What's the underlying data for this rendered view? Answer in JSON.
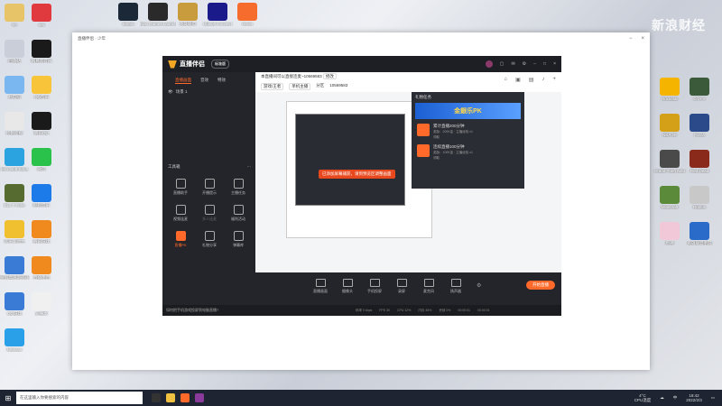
{
  "desktop": {
    "watermark": "新浪财经",
    "left_icons": [
      {
        "label": "hy",
        "color": "#e8c468"
      },
      {
        "label": "回收站",
        "color": "#c9ced8"
      },
      {
        "label": "此电脑",
        "color": "#7ab7f0"
      },
      {
        "label": "控制面板",
        "color": "#e8e8e8"
      },
      {
        "label": "Microsoft Edge",
        "color": "#2aa3e0"
      },
      {
        "label": "Eco 7 Fobs",
        "color": "#556b2f"
      },
      {
        "label": "欢乐斗地主",
        "color": "#f0c030"
      },
      {
        "label": "搜狗高速浏览器",
        "color": "#3a7bd5"
      },
      {
        "label": "QQ游戏",
        "color": "#3a7bd5"
      },
      {
        "label": "Netease",
        "color": "#29a0e8"
      }
    ],
    "left_icons2": [
      {
        "label": "ww",
        "color": "#e0393e"
      },
      {
        "label": "网易云音乐",
        "color": "#1a1a1a"
      },
      {
        "label": "QQ音乐",
        "color": "#f7c43a"
      },
      {
        "label": "腾讯QQ",
        "color": "#1a1a1a"
      },
      {
        "label": "微信",
        "color": "#2bc24b"
      },
      {
        "label": "酷狗音乐",
        "color": "#1c7be8"
      },
      {
        "label": "腾讯游戏",
        "color": "#f08a1e"
      },
      {
        "label": "直播伴侣",
        "color": "#f08a1e"
      },
      {
        "label": "记事本",
        "color": "#f0f0f0"
      }
    ],
    "top_icons": [
      {
        "label": "Steam",
        "color": "#1b2838"
      },
      {
        "label": "Epic Games Launcher",
        "color": "#2a2a2a"
      },
      {
        "label": "英雄联盟",
        "color": "#c89b3c"
      },
      {
        "label": "Ubisoft Connect",
        "color": "#1a1a8a"
      },
      {
        "label": "Origin",
        "color": "#f56c2d"
      }
    ],
    "right_icons": [
      {
        "label": "Rockstar",
        "color": "#f5b400"
      },
      {
        "label": "GTA V",
        "color": "#3a5a3a"
      },
      {
        "label": "NBA 2K",
        "color": "#d4a017"
      },
      {
        "label": "Forza",
        "color": "#2a4a8a"
      },
      {
        "label": "Grand Theft Auto",
        "color": "#4a4a4a"
      },
      {
        "label": "Red Dead",
        "color": "#8a2a1a"
      },
      {
        "label": "Minecraft",
        "color": "#5a8a3a"
      },
      {
        "label": "Roblox",
        "color": "#c8c8c8"
      },
      {
        "label": "原神",
        "color": "#f0c8d8"
      },
      {
        "label": "英雄联盟手游",
        "color": "#2a6ac8"
      }
    ]
  },
  "host_window": {
    "title": "直播伴侣 · 少年"
  },
  "app": {
    "name": "直播伴侣",
    "version_pill": "标准版",
    "side_tabs": [
      "直播画面",
      "音效",
      "特效"
    ],
    "scene_label": "场景 1",
    "tools_title": "工具箱",
    "tools": [
      {
        "label": "直播助手",
        "hot": false,
        "dim": false
      },
      {
        "label": "开播提示",
        "hot": false,
        "dim": false
      },
      {
        "label": "主播任务",
        "hot": false,
        "dim": false
      },
      {
        "label": "视频连麦",
        "hot": false,
        "dim": false
      },
      {
        "label": "多人连麦",
        "hot": false,
        "dim": true
      },
      {
        "label": "福利活动",
        "hot": false,
        "dim": false
      },
      {
        "label": "直播PK",
        "hot": true,
        "dim": false
      },
      {
        "label": "礼物分享",
        "hot": false,
        "dim": false
      },
      {
        "label": "弹幕库",
        "hot": false,
        "dim": false
      }
    ],
    "side_notice": "如何把手机游戏投屏到电脑直播?",
    "room_title": "本直播间可以直接连麦~10569583",
    "room_edit": "修改",
    "room_tags": [
      "游戏/王者",
      "单机主播",
      "分区",
      "10569583"
    ],
    "preview": {
      "toast": "已添加屏幕捕获，请到预览区调整画面"
    },
    "rank_panel": {
      "title": "礼物任务",
      "banner": "金銀乐PK",
      "items": [
        {
          "title": "累计直播200分钟",
          "sub": "奖励：200K金 · 主播经验 x1",
          "badge": "领取"
        },
        {
          "title": "连续直播100分钟",
          "sub": "奖励：100K金 · 主播经验 x1",
          "badge": "领取"
        }
      ]
    },
    "controls": [
      "直播画面",
      "摄像头",
      "手机投屏",
      "录屏",
      "麦克风",
      "扬声器"
    ],
    "start_button": "开始直播",
    "status": [
      "码率 0 kbps",
      "FPS 30",
      "CPU 12%",
      "内存 45%",
      "丢帧 0%"
    ],
    "timer": "00:00:01",
    "timer2": "00:00:01"
  },
  "taskbar": {
    "search_placeholder": "在这里输入你要搜索的内容",
    "weather_temp": "4°C",
    "weather_label": "CPU温度",
    "lang": "中",
    "time": "18:42",
    "date": "2022/2/3"
  }
}
